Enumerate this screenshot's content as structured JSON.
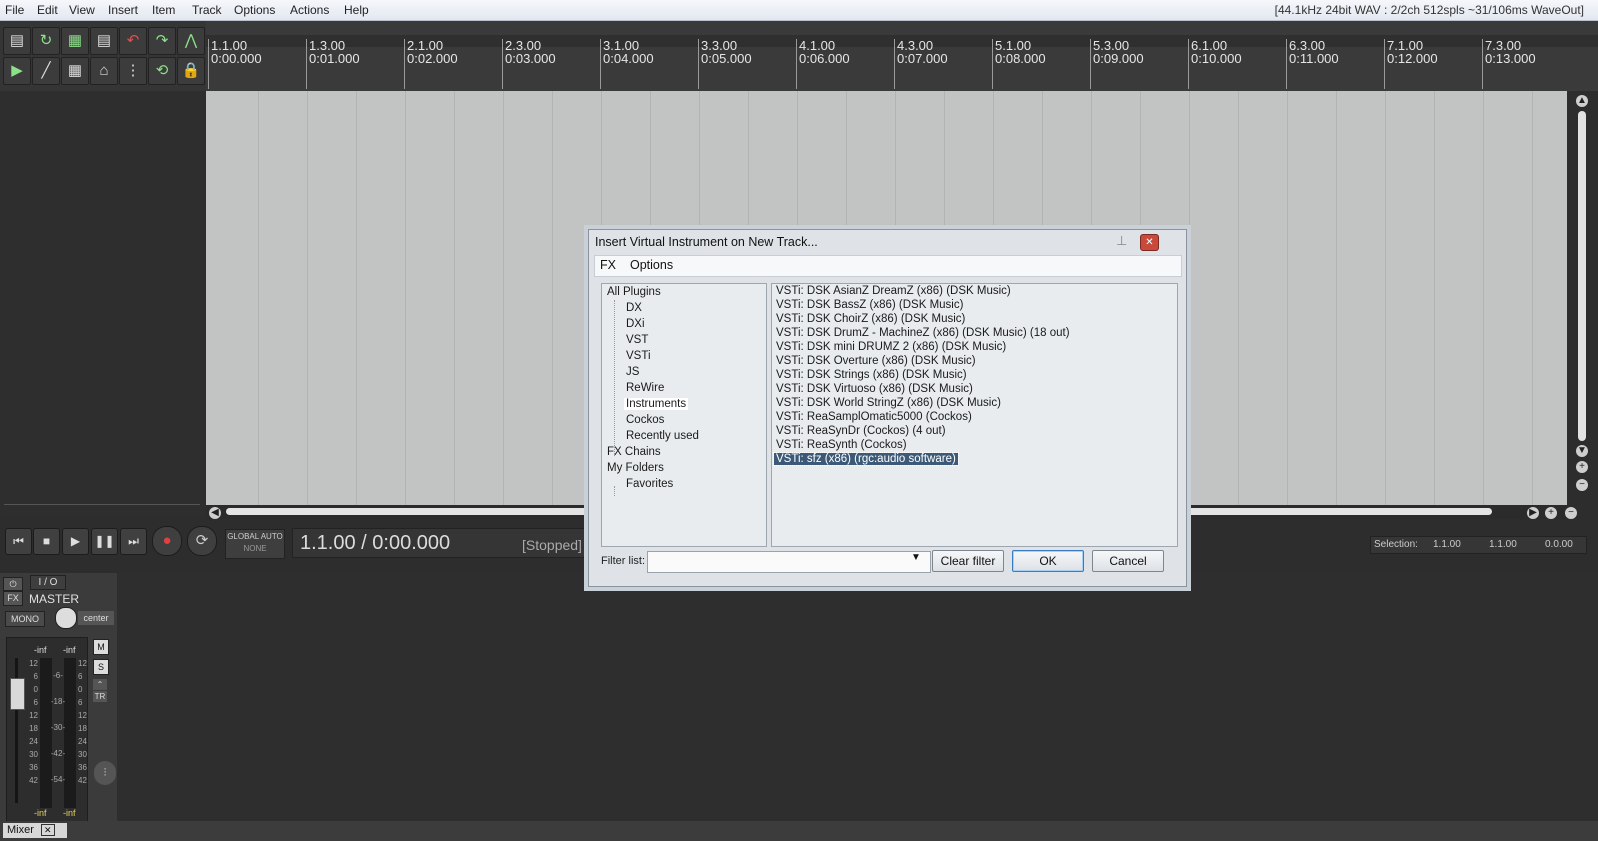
{
  "menubar": {
    "items": [
      "File",
      "Edit",
      "View",
      "Insert",
      "Item",
      "Track",
      "Options",
      "Actions",
      "Help"
    ],
    "status": "[44.1kHz 24bit WAV : 2/2ch 512spls ~31/106ms WaveOut]"
  },
  "ruler": {
    "markers": [
      {
        "bar": "1.1.00",
        "time": "0:00.000"
      },
      {
        "bar": "1.3.00",
        "time": "0:01.000"
      },
      {
        "bar": "2.1.00",
        "time": "0:02.000"
      },
      {
        "bar": "2.3.00",
        "time": "0:03.000"
      },
      {
        "bar": "3.1.00",
        "time": "0:04.000"
      },
      {
        "bar": "3.3.00",
        "time": "0:05.000"
      },
      {
        "bar": "4.1.00",
        "time": "0:06.000"
      },
      {
        "bar": "4.3.00",
        "time": "0:07.000"
      },
      {
        "bar": "5.1.00",
        "time": "0:08.000"
      },
      {
        "bar": "5.3.00",
        "time": "0:09.000"
      },
      {
        "bar": "6.1.00",
        "time": "0:10.000"
      },
      {
        "bar": "6.3.00",
        "time": "0:11.000"
      },
      {
        "bar": "7.1.00",
        "time": "0:12.000"
      },
      {
        "bar": "7.3.00",
        "time": "0:13.000"
      }
    ]
  },
  "transport": {
    "global_auto": "GLOBAL AUTO",
    "global_auto_mode": "NONE",
    "position": "1.1.00 / 0:00.000",
    "state": "[Stopped]",
    "selection_label": "Selection:",
    "selection_start": "1.1.00",
    "selection_end": "1.1.00",
    "selection_length": "0.0.00"
  },
  "master": {
    "io": "I / O",
    "fx": "FX",
    "name": "MASTER",
    "mono": "MONO",
    "pan": "center",
    "peak_left": "-inf",
    "peak_right": "-inf",
    "bottom_left": "-inf",
    "bottom_right": "-inf",
    "scale_left": [
      "12",
      "6",
      "0",
      "6",
      "12",
      "18",
      "24",
      "30",
      "36",
      "42"
    ],
    "scale_mid": [
      "-6-",
      "-18-",
      "-30-",
      "-42-",
      "-54-"
    ],
    "mute": "M",
    "solo": "S",
    "tr": "TR"
  },
  "mixer_tab": "Mixer",
  "dialog": {
    "title": "Insert Virtual Instrument on New Track...",
    "menu": [
      "FX",
      "Options"
    ],
    "tree": [
      {
        "label": "All Plugins",
        "indent": 0
      },
      {
        "label": "DX",
        "indent": 1
      },
      {
        "label": "DXi",
        "indent": 1
      },
      {
        "label": "VST",
        "indent": 1
      },
      {
        "label": "VSTi",
        "indent": 1
      },
      {
        "label": "JS",
        "indent": 1
      },
      {
        "label": "ReWire",
        "indent": 1
      },
      {
        "label": "Instruments",
        "indent": 1,
        "selected": true
      },
      {
        "label": "Cockos",
        "indent": 1
      },
      {
        "label": "Recently used",
        "indent": 1
      },
      {
        "label": "FX Chains",
        "indent": 0
      },
      {
        "label": "My Folders",
        "indent": 0
      },
      {
        "label": "Favorites",
        "indent": 1
      }
    ],
    "plugins": [
      "VSTi: DSK AsianZ DreamZ (x86) (DSK Music)",
      "VSTi: DSK BassZ (x86) (DSK Music)",
      "VSTi: DSK ChoirZ (x86) (DSK Music)",
      "VSTi: DSK DrumZ - MachineZ (x86) (DSK Music) (18 out)",
      "VSTi: DSK mini DRUMZ 2 (x86) (DSK Music)",
      "VSTi: DSK Overture (x86) (DSK Music)",
      "VSTi: DSK Strings (x86) (DSK Music)",
      "VSTi: DSK Virtuoso (x86) (DSK Music)",
      "VSTi: DSK World StringZ (x86) (DSK Music)",
      "VSTi: ReaSamplOmatic5000 (Cockos)",
      "VSTi: ReaSynDr (Cockos) (4 out)",
      "VSTi: ReaSynth (Cockos)",
      "VSTi: sfz (x86) (rgc:audio software)"
    ],
    "selected_plugin": 12,
    "filter_label": "Filter list:",
    "filter_value": "",
    "clear_filter": "Clear filter",
    "ok": "OK",
    "cancel": "Cancel"
  },
  "colors": {
    "arrange_bg": "#c2c4c4",
    "dark_bg": "#2d2d2d",
    "selected_plugin_bg": "#3c5a78",
    "record_red": "#e04040",
    "toolbar_green": "#8de08a"
  }
}
